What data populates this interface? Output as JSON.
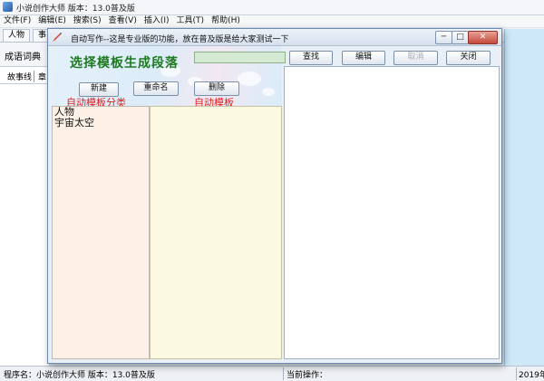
{
  "main_window": {
    "title": "小说创作大师 版本：13.0普及版",
    "menu": [
      "文件(F)",
      "编辑(E)",
      "搜索(S)",
      "查看(V)",
      "插入(I)",
      "工具(T)",
      "帮助(H)"
    ],
    "tabs": [
      "人物",
      "事"
    ],
    "sub_toolbar_label": "成语词典",
    "left_tabs": [
      "故事线",
      "章"
    ]
  },
  "dialog": {
    "title": "自动写作--这是专业版的功能，放在普及版是给大家测试一下",
    "heading": "选择模板生成段落",
    "search_value": "",
    "buttons": {
      "search": "查找",
      "edit": "编辑",
      "cancel": "取消",
      "close": "关闭",
      "new": "新建",
      "rename": "重命名",
      "delete": "删除"
    },
    "column_labels": {
      "categories": "自动模板分类",
      "templates": "自动模板"
    },
    "categories": [
      "人物",
      "宇宙太空"
    ],
    "templates": [],
    "editor_text": ""
  },
  "statusbar": {
    "program_name": "程序名：小说创作大师 版本：13.0普及版",
    "current_op": "当前操作：",
    "year": "2019年"
  },
  "colors": {
    "heading": "#1d7a20",
    "column_label": "#e0211f",
    "category_bg": "#fdf1e7",
    "template_bg": "#fbf9e2",
    "accent_strip": "#cfe8f8"
  }
}
